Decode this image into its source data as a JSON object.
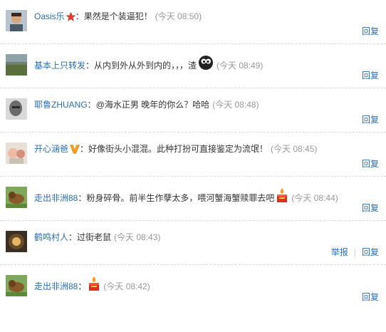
{
  "comments": [
    {
      "user": "Oasis乐",
      "text": "果然是个装逼犯！",
      "time": "(今天 08:50)",
      "reply": "回复"
    },
    {
      "user": "基本上只转发",
      "text": "从内到外从外到内的，，，渣",
      "time": "(今天 08:49)",
      "reply": "回复"
    },
    {
      "user": "耶鲁ZHUANG",
      "text": "@海水正男 晚年的你么？哈哈",
      "time": "(今天 08:48)",
      "reply": "回复"
    },
    {
      "user": "开心涵爸",
      "text": "好像街头小混混。此种打扮可直接鉴定为流氓！",
      "time": "(今天 08:45)",
      "reply": "回复"
    },
    {
      "user": "走出非洲88",
      "text": "粉身碎骨。前半生作孽太多，喂河蟹海蟹赎罪去吧",
      "time": "(今天 08:44)",
      "reply": "回复"
    },
    {
      "user": "鹤鸣村人",
      "text": "过街老鼠",
      "time": "(今天 08:43)",
      "report": "举报",
      "reply": "回复"
    },
    {
      "user": "走出非洲88",
      "text": "",
      "time": "(今天 08:42)",
      "reply": "回复"
    }
  ],
  "colors": {
    "link": "#2a6db3",
    "time": "#999999",
    "text": "#333333"
  }
}
